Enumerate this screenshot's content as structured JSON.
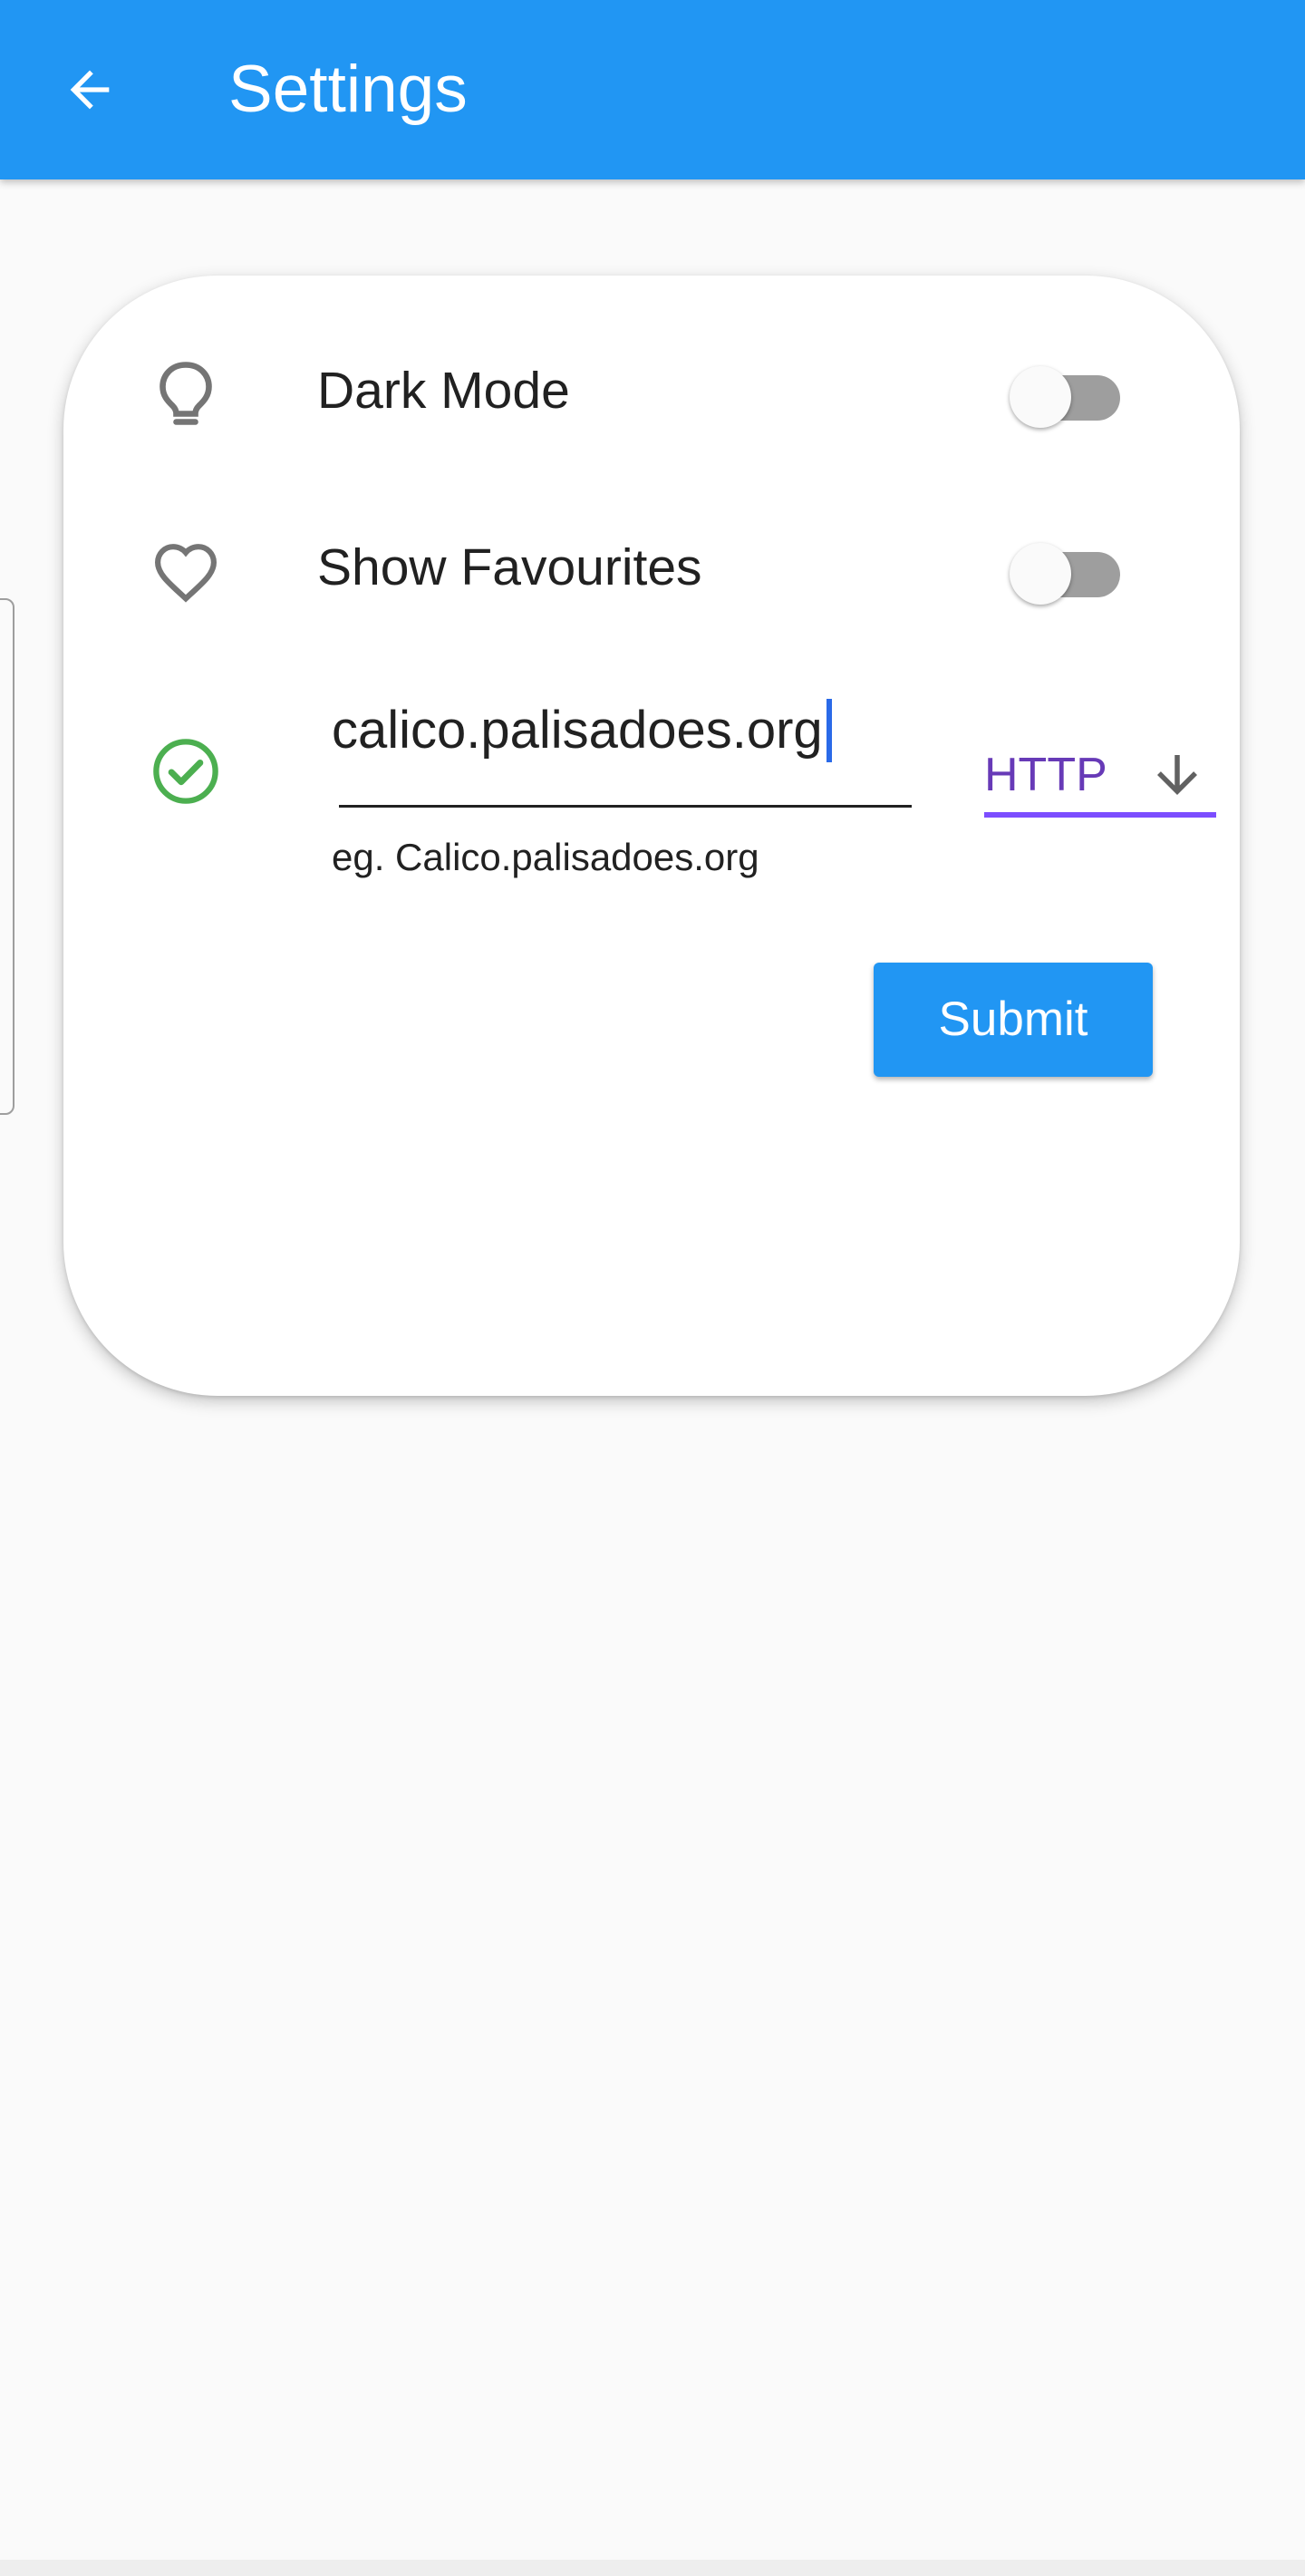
{
  "app_bar": {
    "title": "Settings",
    "back_icon": "arrow-back-icon",
    "color": "#2196f3"
  },
  "settings": {
    "dark_mode": {
      "icon": "lightbulb-icon",
      "label": "Dark Mode",
      "enabled": false
    },
    "show_favourites": {
      "icon": "heart-icon",
      "label": "Show Favourites",
      "enabled": false
    },
    "server": {
      "status_icon": "check-circle-icon",
      "status_color": "#4caf50",
      "url_value": "calico.palisadoes.org",
      "helper_text": "eg. Calico.palisadoes.org",
      "protocol_selected": "HTTP",
      "protocol_color": "#673ab7"
    }
  },
  "submit_label": "Submit"
}
